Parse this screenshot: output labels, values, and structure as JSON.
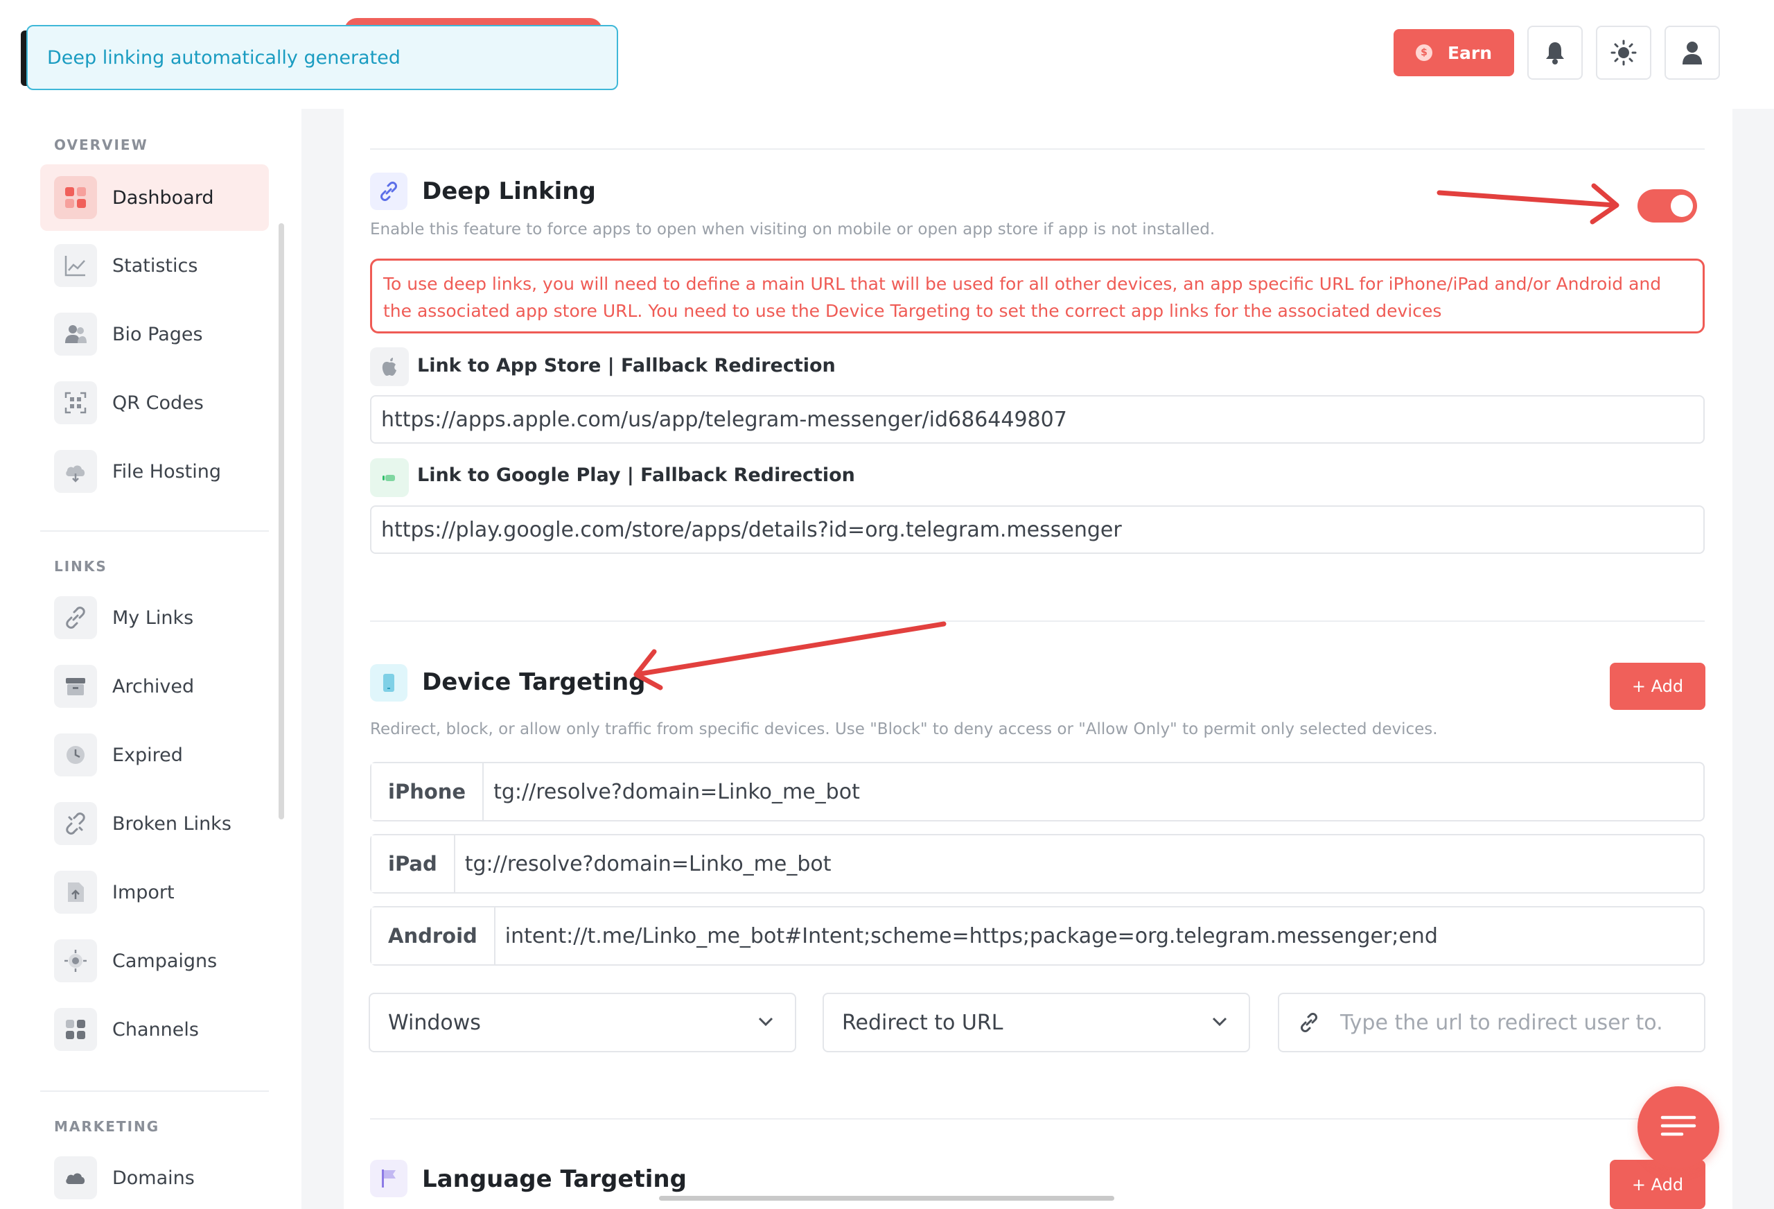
{
  "toast": {
    "message": "Deep linking automatically generated"
  },
  "header": {
    "earn_label": "Earn",
    "earn_coin_symbol": "$",
    "icons": [
      "bell-icon",
      "sun-icon",
      "user-icon"
    ]
  },
  "sidebar": {
    "sections": [
      {
        "label": "OVERVIEW"
      },
      {
        "label": "LINKS"
      },
      {
        "label": "MARKETING"
      }
    ],
    "items": [
      {
        "label": "Dashboard",
        "icon": "dashboard-icon",
        "active": true
      },
      {
        "label": "Statistics",
        "icon": "chart-icon"
      },
      {
        "label": "Bio Pages",
        "icon": "users-icon"
      },
      {
        "label": "QR Codes",
        "icon": "qr-icon"
      },
      {
        "label": "File Hosting",
        "icon": "cloud-icon"
      },
      {
        "label": "My Links",
        "icon": "link-icon"
      },
      {
        "label": "Archived",
        "icon": "archive-icon"
      },
      {
        "label": "Expired",
        "icon": "clock-icon"
      },
      {
        "label": "Broken Links",
        "icon": "broken-link-icon"
      },
      {
        "label": "Import",
        "icon": "import-icon"
      },
      {
        "label": "Campaigns",
        "icon": "target-icon"
      },
      {
        "label": "Channels",
        "icon": "grid-icon"
      },
      {
        "label": "Domains",
        "icon": "cloud-icon"
      }
    ]
  },
  "deep_linking": {
    "title": "Deep Linking",
    "description": "Enable this feature to force apps to open when visiting on mobile or open app store if app is not installed.",
    "enabled": true,
    "warning_line1": "To use deep links, you will need to define a main URL that will be used for all other devices, an app specific URL for iPhone/iPad and/or Android and",
    "warning_line2": "the associated app store URL. You need to use the Device Targeting to set the correct app links for the associated devices",
    "app_store_label": "Link to App Store | Fallback Redirection",
    "app_store_url": "https://apps.apple.com/us/app/telegram-messenger/id686449807",
    "google_play_label": "Link to Google Play | Fallback Redirection",
    "google_play_url": "https://play.google.com/store/apps/details?id=org.telegram.messenger"
  },
  "device_targeting": {
    "title": "Device Targeting",
    "add_label": "+ Add",
    "description": "Redirect, block, or allow only traffic from specific devices. Use \"Block\" to deny access or \"Allow Only\" to permit only selected devices.",
    "rows": [
      {
        "device": "iPhone",
        "value": "tg://resolve?domain=Linko_me_bot"
      },
      {
        "device": "iPad",
        "value": "tg://resolve?domain=Linko_me_bot"
      },
      {
        "device": "Android",
        "value": "intent://t.me/Linko_me_bot#Intent;scheme=https;package=org.telegram.messenger;end"
      }
    ],
    "new_device_select": "Windows",
    "new_action_select": "Redirect to URL",
    "new_url_placeholder": "Type the url to redirect user to."
  },
  "language_targeting": {
    "title": "Language Targeting",
    "add_label": "+ Add"
  },
  "colors": {
    "accent": "#f0605a",
    "toast_border": "#3fb8d8",
    "toast_text": "#1a9cc1",
    "annotation_arrow": "#e2403e"
  }
}
